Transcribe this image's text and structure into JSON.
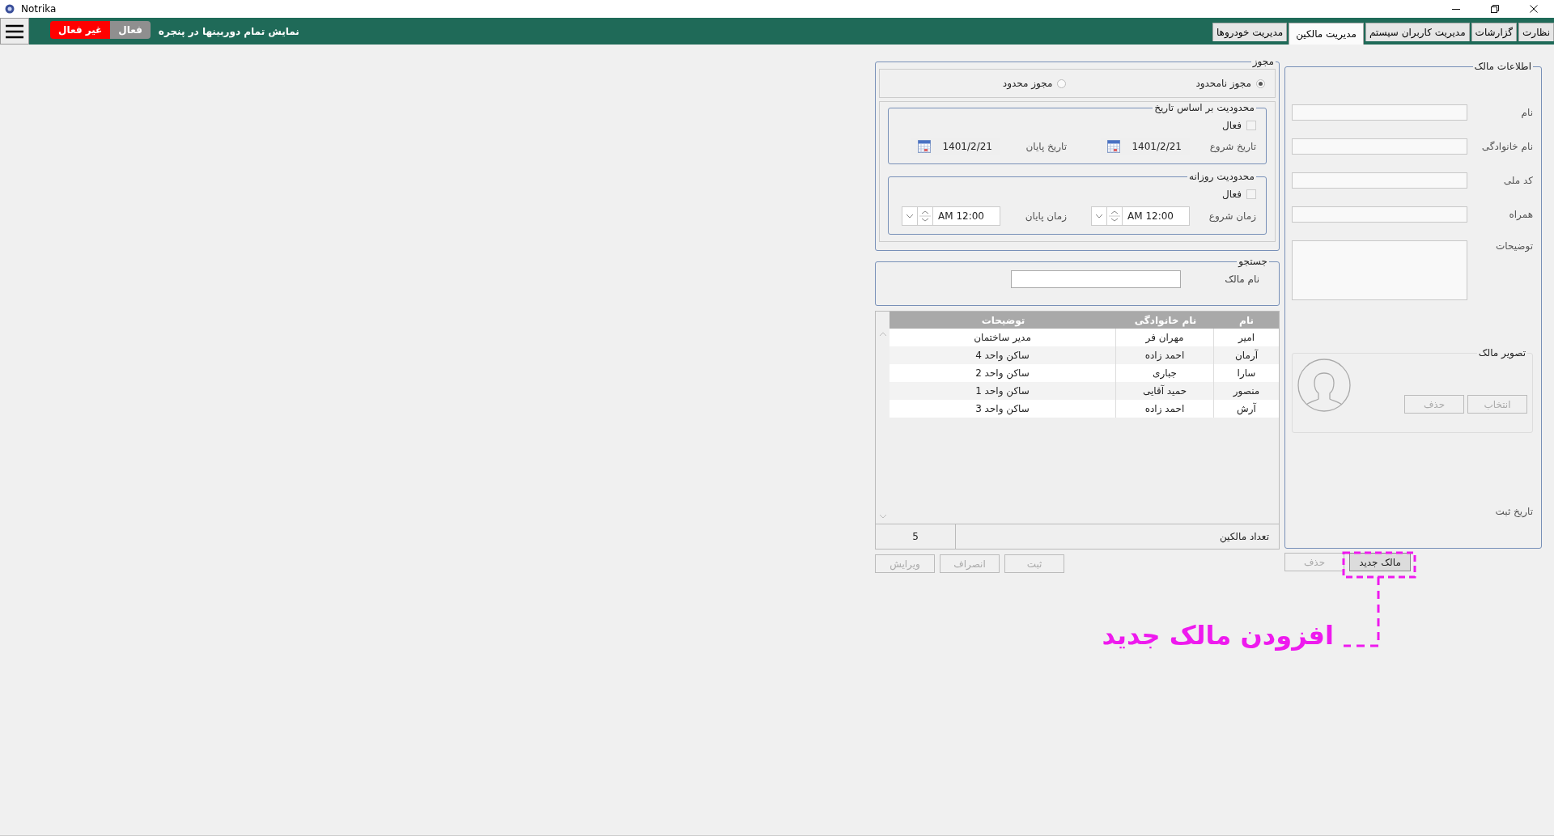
{
  "window": {
    "title": "Notrika"
  },
  "toolbar": {
    "tabs": [
      {
        "label": "نظارت",
        "selected": false
      },
      {
        "label": "گزارشات",
        "selected": false
      },
      {
        "label": "مدیریت کاربران سیستم",
        "selected": false
      },
      {
        "label": "مدیریت مالکین",
        "selected": true
      },
      {
        "label": "مدیریت خودروها",
        "selected": false
      }
    ],
    "camera_label": "نمایش تمام دوربینها در پنجره",
    "toggle": [
      {
        "label": "فعال",
        "selected": false
      },
      {
        "label": "غیر فعال",
        "selected": true
      }
    ]
  },
  "owner_info": {
    "title": "اطلاعات مالک",
    "fields": [
      {
        "label": "نام",
        "kind": "text"
      },
      {
        "label": "نام خانوادگی",
        "kind": "text"
      },
      {
        "label": "کد ملی",
        "kind": "text"
      },
      {
        "label": "همراه",
        "kind": "text"
      },
      {
        "label": "توضیحات",
        "kind": "textarea"
      }
    ],
    "photo": {
      "title": "تصویر مالک",
      "buttons": [
        {
          "label": "انتخاب",
          "disabled": true
        },
        {
          "label": "حذف",
          "disabled": true
        }
      ]
    },
    "registration_label": "تاریخ ثبت"
  },
  "owner_buttons": [
    {
      "label": "مالک جدید",
      "disabled": false
    },
    {
      "label": "حذف",
      "disabled": true
    }
  ],
  "license": {
    "title": "مجوز",
    "options": [
      {
        "label": "مجوز نامحدود",
        "selected": true
      },
      {
        "label": "مجوز محدود",
        "selected": false
      }
    ],
    "limits": [
      {
        "kind": "date",
        "title": "محدودیت بر اساس تاریخ",
        "active": {
          "label": "فعال",
          "checked": false
        },
        "start": {
          "label": "تاریخ شروع",
          "value": "1401/2/21"
        },
        "end": {
          "label": "تاریخ پایان",
          "value": "1401/2/21"
        }
      },
      {
        "kind": "time",
        "title": "محدودیت روزانه",
        "active": {
          "label": "فعال",
          "checked": false
        },
        "start": {
          "label": "زمان شروع",
          "value": "AM 12:00"
        },
        "end": {
          "label": "زمان پایان",
          "value": "AM 12:00"
        }
      }
    ]
  },
  "search": {
    "title": "جستجو",
    "label": "نام مالک"
  },
  "table": {
    "columns": [
      "نام",
      "نام خانوادگی",
      "توضیحات"
    ],
    "rows": [
      [
        "امیر",
        "مهران فر",
        "مدیر ساختمان"
      ],
      [
        "آرمان",
        "احمد زاده",
        "ساکن واحد 4"
      ],
      [
        "سارا",
        "جباری",
        "ساکن واحد 2"
      ],
      [
        "منصور",
        "حمید آقایی",
        "ساکن واحد 1"
      ],
      [
        "آرش",
        "احمد زاده",
        "ساکن واحد 3"
      ]
    ],
    "footer": {
      "label": "تعداد مالکین",
      "value": "5"
    }
  },
  "form_buttons": [
    {
      "label": "ثبت",
      "disabled": true
    },
    {
      "label": "انصراف",
      "disabled": true
    },
    {
      "label": "ویرایش",
      "disabled": true
    }
  ],
  "annotation": {
    "text": "افزودن مالک جدید"
  }
}
